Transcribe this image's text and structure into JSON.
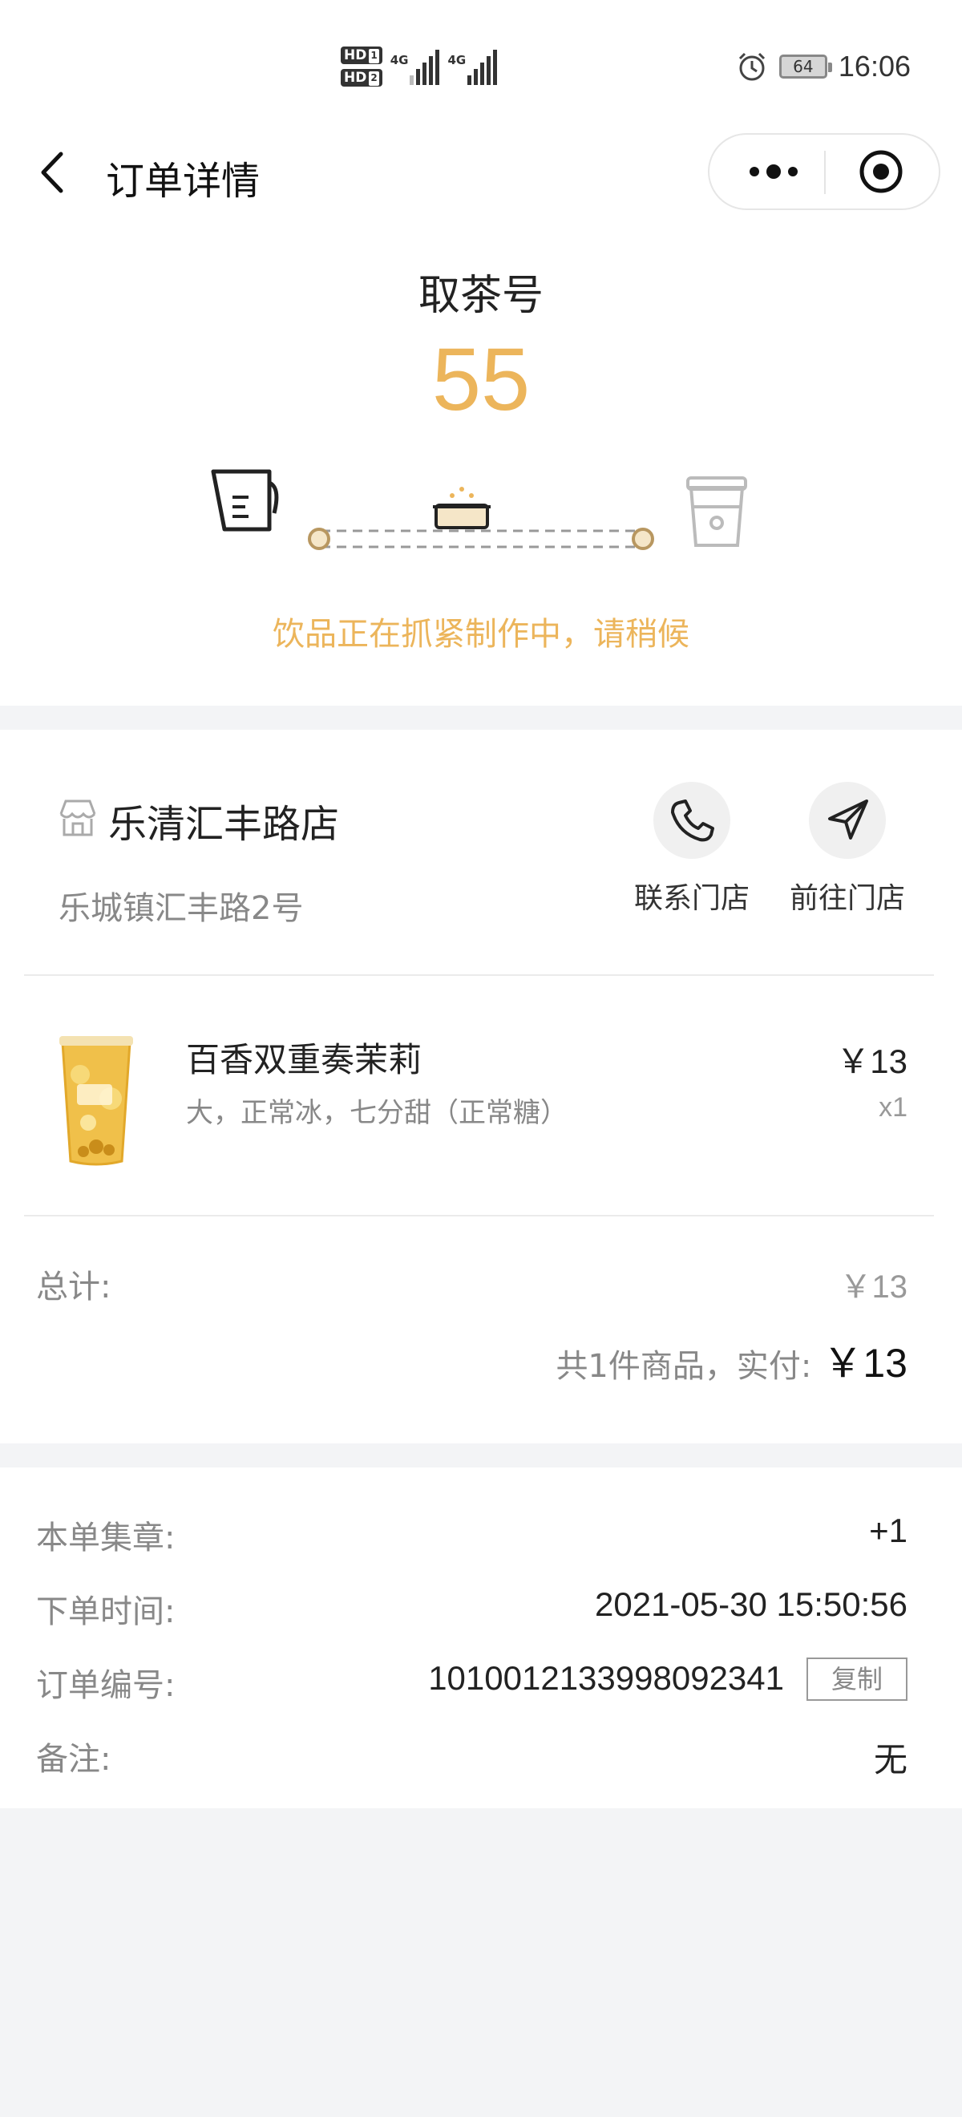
{
  "status_bar": {
    "network": "4G",
    "sim1": "HD",
    "sim2": "HD",
    "battery": "64",
    "time": "16:06",
    "icons": [
      "hd-icon",
      "signal-icon",
      "alarm-icon",
      "battery-icon"
    ]
  },
  "nav": {
    "title": "订单详情",
    "icons": [
      "back-icon",
      "more-icon",
      "close-circle-icon"
    ]
  },
  "pickup": {
    "label": "取茶号",
    "number": "55",
    "status_message": "饮品正在抓紧制作中，请稍候",
    "accent_color": "#ecb55b",
    "steps": [
      "shaker-icon",
      "prep-box-icon",
      "cup-icon"
    ]
  },
  "store": {
    "name": "乐清汇丰路店",
    "address": "乐城镇汇丰路2号",
    "actions": [
      {
        "label": "联系门店",
        "icon": "phone-icon"
      },
      {
        "label": "前往门店",
        "icon": "navigate-icon"
      }
    ]
  },
  "product": {
    "name": "百香双重奏茉莉",
    "spec": "大，正常冰，七分甜（正常糖）",
    "price": "￥13",
    "qty": "x1"
  },
  "totals": {
    "label": "总计:",
    "value": "￥13",
    "summary": "共1件商品，实付:",
    "paid": "￥13"
  },
  "info": {
    "stamps_label": "本单集章:",
    "stamps_value": "+1",
    "time_label": "下单时间:",
    "time_value": "2021-05-30 15:50:56",
    "order_label": "订单编号:",
    "order_value": "1010012133998092341",
    "copy_label": "复制",
    "note_label": "备注:",
    "note_value": "无"
  }
}
